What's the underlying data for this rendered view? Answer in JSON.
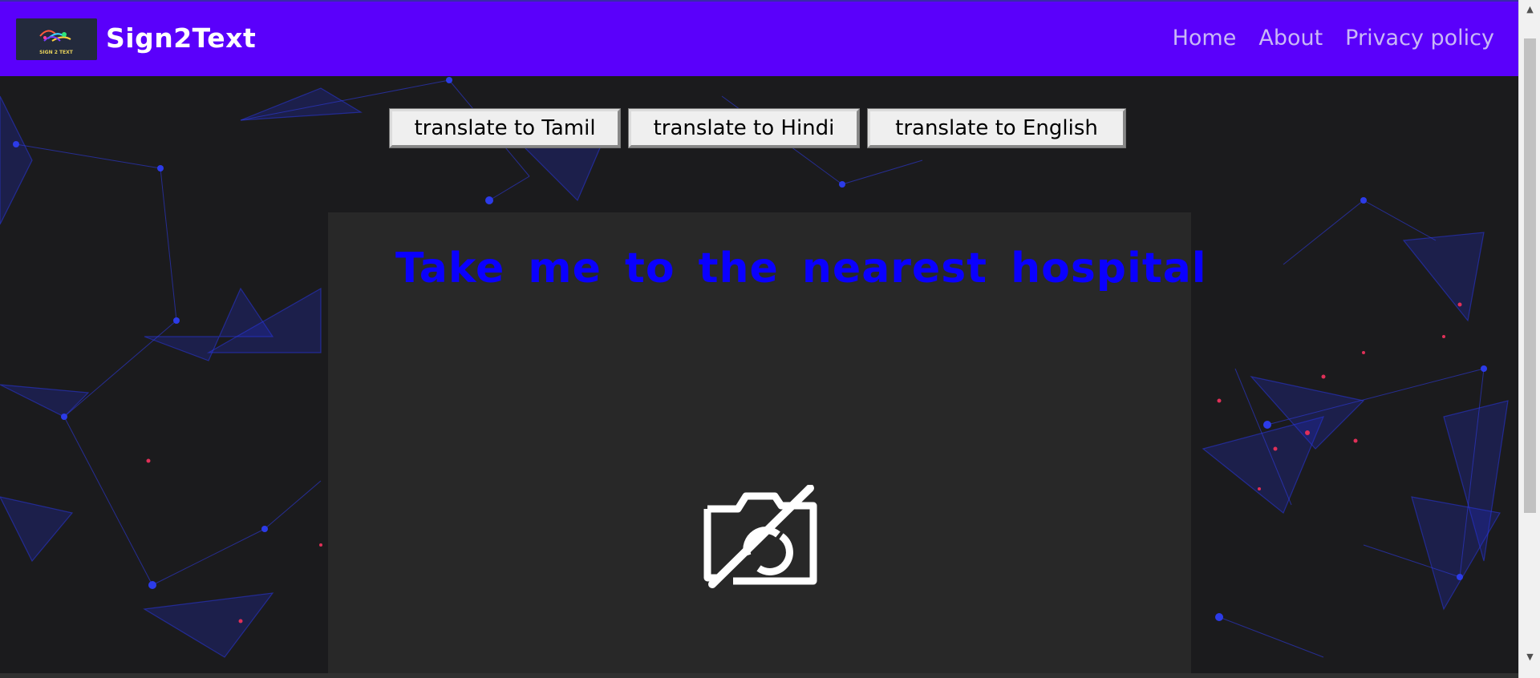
{
  "brand": {
    "name": "Sign2Text",
    "logo_caption": "SIGN 2 TEXT"
  },
  "nav": {
    "items": [
      {
        "label": "Home"
      },
      {
        "label": "About"
      },
      {
        "label": "Privacy policy"
      }
    ]
  },
  "translate_buttons": {
    "tamil": "translate to Tamil",
    "hindi": "translate to Hindi",
    "english": "translate to English"
  },
  "output": {
    "text": "Take me to the nearest hospital"
  },
  "icons": {
    "camera": "camera-off-icon",
    "scroll_up": "chevron-up-icon",
    "scroll_down": "chevron-down-icon"
  },
  "colors": {
    "navbar": "#5a00fb",
    "output_text": "#0a00ff",
    "panel": "#282828",
    "nav_link": "#c9b8f6"
  }
}
